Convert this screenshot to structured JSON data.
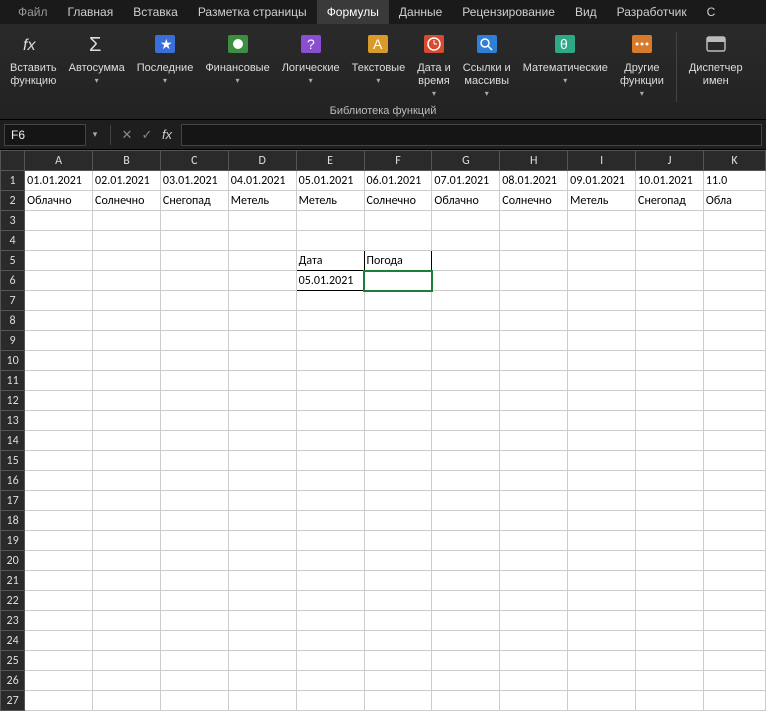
{
  "menu": {
    "file": "Файл",
    "home": "Главная",
    "insert": "Вставка",
    "pagelayout": "Разметка страницы",
    "formulas": "Формулы",
    "data": "Данные",
    "review": "Рецензирование",
    "view": "Вид",
    "developer": "Разработчик",
    "extra": "С"
  },
  "ribbon": {
    "insert_fn": "Вставить\nфункцию",
    "autosum": "Автосумма",
    "recent": "Последние",
    "financial": "Финансовые",
    "logical": "Логические",
    "text": "Текстовые",
    "datetime": "Дата и\nвремя",
    "lookup": "Ссылки и\nмассивы",
    "math": "Математические",
    "more": "Другие\nфункции",
    "namemgr": "Диспетчер\nимен",
    "caption": "Библиотека функций"
  },
  "formula_bar": {
    "name_box": "F6",
    "fx_label": "fx",
    "formula": ""
  },
  "columns": [
    "A",
    "B",
    "C",
    "D",
    "E",
    "F",
    "G",
    "H",
    "I",
    "J",
    "K"
  ],
  "cells": {
    "row1": [
      "01.01.2021",
      "02.01.2021",
      "03.01.2021",
      "04.01.2021",
      "05.01.2021",
      "06.01.2021",
      "07.01.2021",
      "08.01.2021",
      "09.01.2021",
      "10.01.2021",
      "11.0"
    ],
    "row2": [
      "Облачно",
      "Солнечно",
      "Снегопад",
      "Метель",
      "Метель",
      "Солнечно",
      "Облачно",
      "Солнечно",
      "Метель",
      "Снегопад",
      "Обла"
    ],
    "E5": "Дата",
    "F5": "Погода",
    "E6": "05.01.2021"
  },
  "selected_cell": "F6"
}
